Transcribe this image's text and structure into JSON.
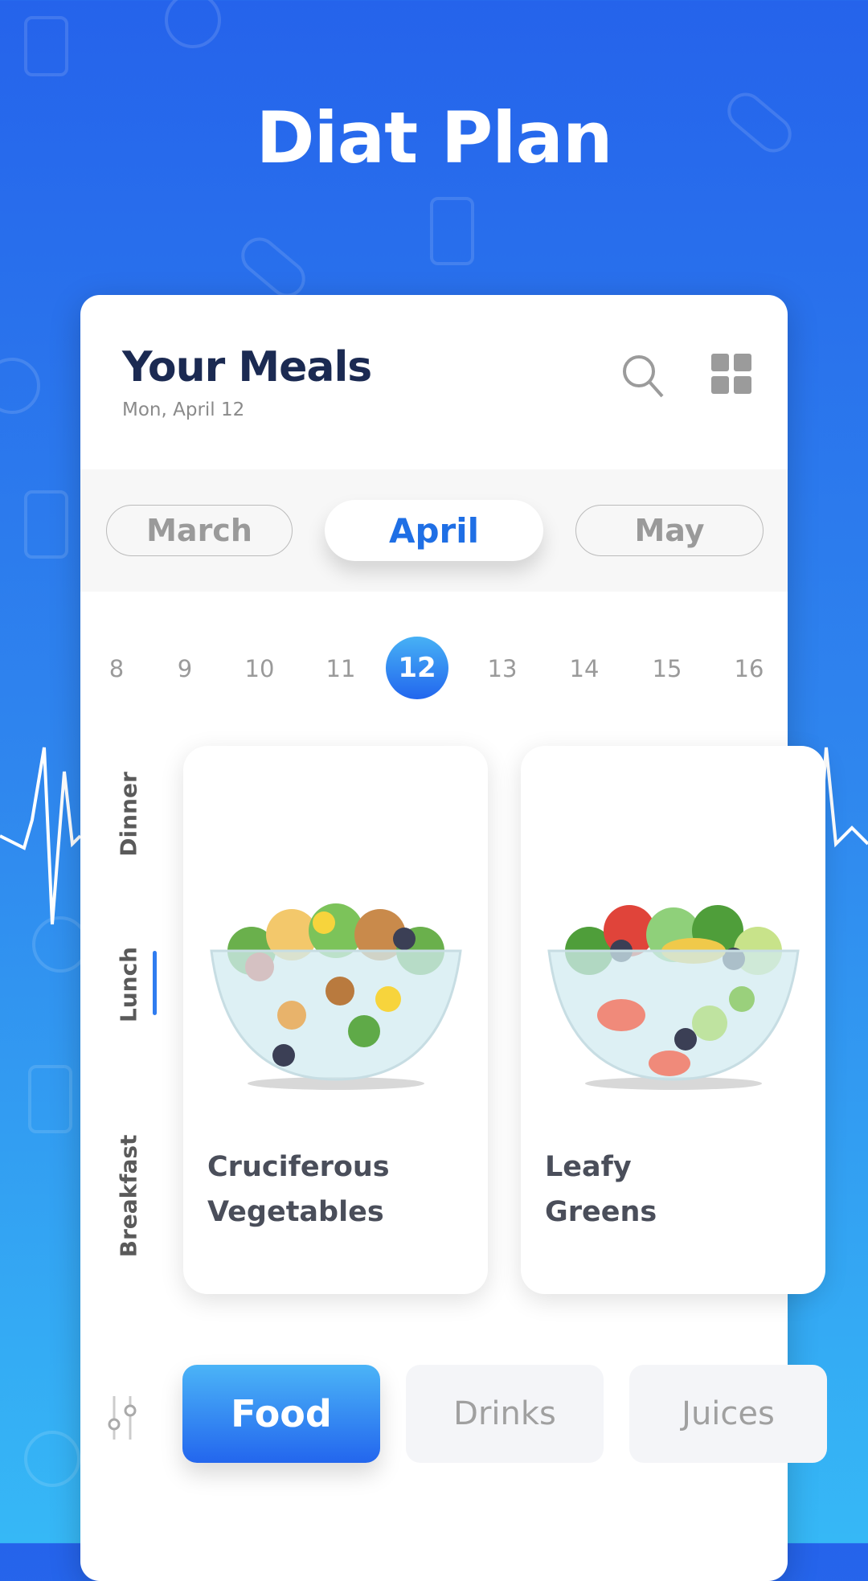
{
  "app": {
    "title": "Diat Plan"
  },
  "header": {
    "title": "Your Meals",
    "date": "Mon, April 12",
    "icons": [
      "search-icon",
      "grid-icon"
    ]
  },
  "months": [
    {
      "label": "March",
      "active": false
    },
    {
      "label": "April",
      "active": true
    },
    {
      "label": "May",
      "active": false
    }
  ],
  "days": [
    "8",
    "9",
    "10",
    "11",
    "12",
    "13",
    "14",
    "15",
    "16"
  ],
  "selected_day": "12",
  "meal_tabs": [
    {
      "label": "Dinner"
    },
    {
      "label": "Lunch",
      "active": true
    },
    {
      "label": "Breakfast"
    }
  ],
  "meals": [
    {
      "line1": "Cruciferous",
      "line2": "Vegetables"
    },
    {
      "line1": "Leafy",
      "line2": "Greens"
    }
  ],
  "categories": [
    {
      "label": "Food",
      "active": true
    },
    {
      "label": "Drinks"
    },
    {
      "label": "Juices"
    }
  ],
  "colors": {
    "accent": "#2366ee",
    "title": "#1b2a52",
    "background_top": "#2563eb",
    "background_bottom": "#36b8f6"
  }
}
